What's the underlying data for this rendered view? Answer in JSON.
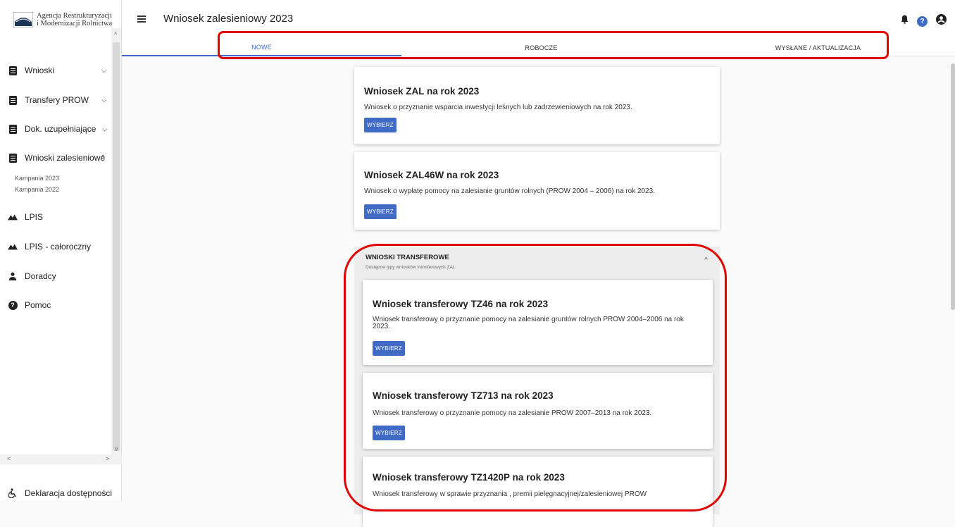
{
  "logo": {
    "line1": "Agencja Restrukturyzacji",
    "line2": "i Modernizacji Rolnictwa"
  },
  "header": {
    "title": "Wniosek zalesieniowy 2023"
  },
  "sidebar": {
    "items": [
      {
        "label": "Wnioski",
        "icon": "document-icon"
      },
      {
        "label": "Transfery PROW",
        "icon": "document-icon"
      },
      {
        "label": "Dok. uzupełniające",
        "icon": "document-icon"
      },
      {
        "label": "Wnioski zalesieniowe",
        "icon": "document-icon"
      },
      {
        "label": "LPIS",
        "icon": "mountain-icon"
      },
      {
        "label": "LPIS - całoroczny",
        "icon": "mountain-icon"
      },
      {
        "label": "Doradcy",
        "icon": "person-icon"
      },
      {
        "label": "Pomoc",
        "icon": "help-icon"
      }
    ],
    "subitems": [
      "Kampania 2023",
      "Kampania 2022"
    ],
    "footer": "Deklaracja dostępności"
  },
  "tabs": [
    "NOWE",
    "ROBOCZE",
    "WYSŁANE / AKTUALIZACJA"
  ],
  "cards": [
    {
      "title": "Wniosek ZAL na rok 2023",
      "desc": "Wniosek o przyznanie wsparcia inwestycji leśnych lub zadrzewieniowych na rok 2023.",
      "button": "WYBIERZ"
    },
    {
      "title": "Wniosek ZAL46W na rok 2023",
      "desc": "Wniosek o wypłatę pomocy na zalesianie gruntów rolnych (PROW 2004 – 2006) na rok 2023.",
      "button": "WYBIERZ"
    }
  ],
  "transfer_panel": {
    "title": "WNIOSKI TRANSFEROWE",
    "subtitle": "Dostępne typy wniosków transferowych ZAL",
    "cards": [
      {
        "title": "Wniosek transferowy TZ46 na rok 2023",
        "desc1": "Wniosek transferowy o przyznanie pomocy na zalesianie gruntów rolnych PROW 2004–2006 na rok",
        "desc2": "2023.",
        "button": "WYBIERZ"
      },
      {
        "title": "Wniosek transferowy TZ713 na rok 2023",
        "desc1": "Wniosek transferowy o przyznanie pomocy na zalesianie PROW 2007–2013 na rok 2023.",
        "button": "WYBIERZ"
      },
      {
        "title": "Wniosek transferowy TZ1420P na rok 2023",
        "desc1": "Wniosek transferowy w sprawie przyznania        , premii pielęgnacyjnej/zalesieniowej PROW"
      }
    ]
  },
  "colors": {
    "accent": "#3f6bc4",
    "highlight": "#e00000"
  }
}
